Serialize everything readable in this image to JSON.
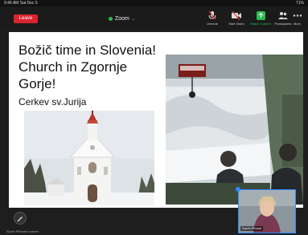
{
  "status": {
    "time": "9:46 AM  Sat Dec 5",
    "right": "71%"
  },
  "toolbar": {
    "leave": "Leave",
    "meeting_title": "Zoom",
    "tools": [
      {
        "label": "Unmute",
        "icon": "mic-muted-icon"
      },
      {
        "label": "Start Video",
        "icon": "video-off-icon"
      },
      {
        "label": "Share Content",
        "icon": "share-screen-icon"
      },
      {
        "label": "Participants",
        "icon": "participants-icon"
      },
      {
        "label": "More",
        "icon": "more-icon"
      }
    ]
  },
  "slide": {
    "title": "Božič time in Slovenia! Church in Zgornje Gorje!",
    "subtitle": "Cerkev sv.Jurija"
  },
  "share": {
    "presenter_label": "Suzi's iPhone's screen"
  },
  "video_tile": {
    "name": "Suzi's iPhone"
  },
  "colors": {
    "leave": "#d9232e",
    "accent_green": "#2dbb4f",
    "accent_blue": "#2d8cff"
  }
}
